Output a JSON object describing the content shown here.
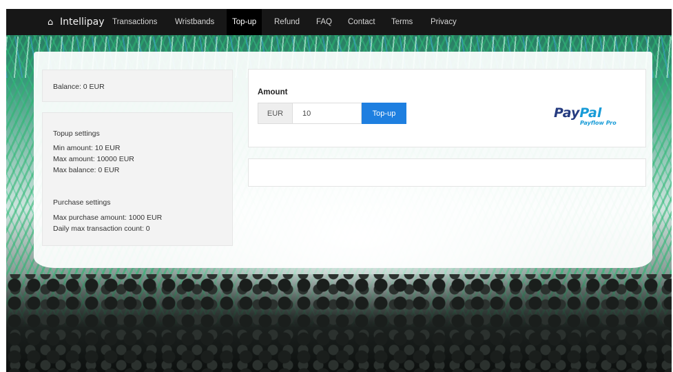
{
  "navbar": {
    "brand": "Intellipay",
    "brand_icon": "home-icon",
    "items": [
      {
        "label": "Transactions"
      },
      {
        "label": "Wristbands"
      },
      {
        "label": "Top-up",
        "active": true
      },
      {
        "label": "Refund"
      },
      {
        "label": "FAQ"
      },
      {
        "label": "Contact"
      },
      {
        "label": "Terms"
      },
      {
        "label": "Privacy"
      }
    ]
  },
  "sidebar": {
    "balance": "Balance: 0 EUR",
    "topup_settings": {
      "heading": "Topup settings",
      "lines": [
        "Min amount: 10 EUR",
        "Max amount: 10000 EUR",
        "Max balance: 0 EUR"
      ]
    },
    "purchase_settings": {
      "heading": "Purchase settings",
      "lines": [
        "Max purchase amount: 1000 EUR",
        "Daily max transaction count: 0"
      ]
    }
  },
  "topup_form": {
    "amount_label": "Amount",
    "currency": "EUR",
    "amount_value": "10",
    "submit_label": "Top-up"
  },
  "payment_logo": {
    "pay": "Pay",
    "pal": "Pal",
    "sub": "Payflow Pro"
  },
  "colors": {
    "navbar_bg": "#171717",
    "accent": "#1e7fe0",
    "paypal_dark": "#253b80",
    "paypal_light": "#179bd7"
  }
}
